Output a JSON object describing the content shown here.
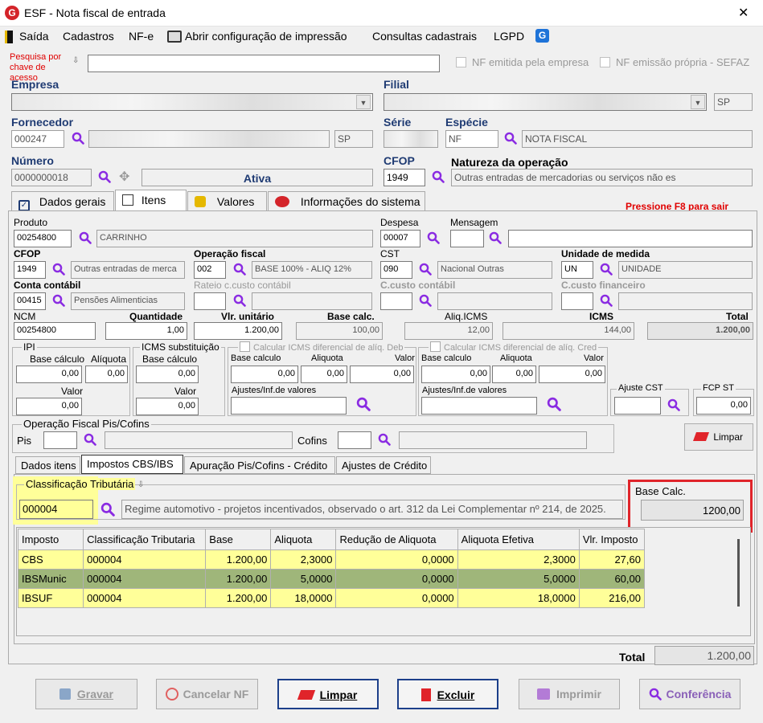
{
  "window": {
    "title": "ESF - Nota fiscal de entrada"
  },
  "menu": {
    "saida": "Saída",
    "cadastros": "Cadastros",
    "nfe": "NF-e",
    "print": "Abrir configuração de impressão",
    "consultas": "Consultas cadastrais",
    "lgpd": "LGPD"
  },
  "search": {
    "label": "Pesquisa por chave de acesso",
    "value": ""
  },
  "flags": {
    "nf_empresa": "NF emitida pela empresa",
    "nf_propria": "NF emissão própria - SEFAZ"
  },
  "empresa": {
    "label": "Empresa"
  },
  "filial": {
    "label": "Filial",
    "uf": "SP"
  },
  "fornecedor": {
    "label": "Fornecedor",
    "code": "000247",
    "uf": "SP"
  },
  "serie": {
    "label": "Série",
    "value": "NF"
  },
  "especie": {
    "label": "Espécie",
    "value": "NOTA FISCAL"
  },
  "numero": {
    "label": "Número",
    "value": "0000000018",
    "status": "Ativa"
  },
  "cfop": {
    "label": "CFOP",
    "value": "1949"
  },
  "natureza": {
    "label": "Natureza da operação",
    "value": "Outras entradas  de mercadorias ou serviços não es"
  },
  "tabs": [
    "Dados gerais",
    "Itens",
    "Valores",
    "Informações do sistema"
  ],
  "hint": "Pressione F8 para sair",
  "item": {
    "produto_label": "Produto",
    "produto_code": "00254800",
    "produto_name": "CARRINHO",
    "despesa_label": "Despesa",
    "despesa": "00007",
    "mensagem_label": "Mensagem",
    "cfop_label": "CFOP",
    "cfop": "1949",
    "cfop_desc": "Outras entradas  de merca",
    "opfiscal_label": "Operação fiscal",
    "opfiscal": "002",
    "opfiscal_desc": "BASE 100% - ALIQ 12%",
    "cst_label": "CST",
    "cst": "090",
    "cst_desc": "Nacional Outras",
    "unidade_label": "Unidade de medida",
    "unidade": "UN",
    "unidade_desc": "UNIDADE",
    "conta_label": "Conta contábil",
    "conta": "00415",
    "conta_desc": "Pensões Alimenticias",
    "rateio_label": "Rateio c.custo contábil",
    "ccusto_label": "C.custo contábil",
    "ccfin_label": "C.custo financeiro",
    "ncm_label": "NCM",
    "ncm": "00254800",
    "qtd_label": "Quantidade",
    "qtd": "1,00",
    "vunit_label": "Vlr. unitário",
    "vunit": "1.200,00",
    "base_label": "Base calc.",
    "base": "100,00",
    "aliq_label": "Aliq.ICMS",
    "aliq": "12,00",
    "icms_label": "ICMS",
    "icms": "144,00",
    "total_label": "Total",
    "total": "1.200,00"
  },
  "ipi": {
    "label": "IPI",
    "base_label": "Base cálculo",
    "base": "0,00",
    "aliq_label": "Alíquota",
    "aliq": "0,00",
    "valor_label": "Valor",
    "valor": "0,00"
  },
  "st": {
    "label": "ICMS substituição",
    "base_label": "Base cálculo",
    "base": "0,00",
    "valor_label": "Valor",
    "valor": "0,00"
  },
  "difdeb": {
    "label": "Calcular ICMS diferencial de alíq. Deb",
    "base_label": "Base calculo",
    "base": "0,00",
    "aliq_label": "Aliquota",
    "aliq": "0,00",
    "valor_label": "Valor",
    "valor": "0,00",
    "ajuste_label": "Ajustes/Inf.de valores"
  },
  "difcred": {
    "label": "Calcular ICMS diferencial de alíq. Cred",
    "base_label": "Base calculo",
    "base": "0,00",
    "aliq_label": "Aliquota",
    "aliq": "0,00",
    "valor_label": "Valor",
    "valor": "0,00",
    "ajuste_label": "Ajustes/Inf.de valores"
  },
  "ajustecst": {
    "label": "Ajuste CST"
  },
  "fcpst": {
    "label": "FCP ST",
    "value": "0,00"
  },
  "piscofins": {
    "label": "Operação Fiscal Pis/Cofins",
    "pis_label": "Pis",
    "cofins_label": "Cofins"
  },
  "limpar_small": "Limpar",
  "subtabs": [
    "Dados itens",
    "Impostos CBS/IBS",
    "Apuração Pis/Cofins - Crédito",
    "Ajustes de Crédito"
  ],
  "classif": {
    "label": "Classificação Tributária",
    "code": "000004",
    "desc": "Regime automotivo - projetos incentivados, observado o art. 312 da Lei Complementar nº 214, de 2025."
  },
  "basecalc": {
    "label": "Base Calc.",
    "value": "1200,00"
  },
  "grid": {
    "headers": [
      "Imposto",
      "Classificação Tributaria",
      "Base",
      "Aliquota",
      "Redução de Aliquota",
      "Aliquota Efetiva",
      "Vlr. Imposto"
    ],
    "rows": [
      [
        "CBS",
        "000004",
        "1.200,00",
        "2,3000",
        "0,0000",
        "2,3000",
        "27,60"
      ],
      [
        "IBSMunic",
        "000004",
        "1.200,00",
        "5,0000",
        "0,0000",
        "5,0000",
        "60,00"
      ],
      [
        "IBSUF",
        "000004",
        "1.200,00",
        "18,0000",
        "0,0000",
        "18,0000",
        "216,00"
      ]
    ]
  },
  "footer": {
    "total_label": "Total",
    "total": "1.200,00"
  },
  "buttons": {
    "gravar": "Gravar",
    "cancelar": "Cancelar NF",
    "limpar": "Limpar",
    "excluir": "Excluir",
    "imprimir": "Imprimir",
    "conferencia": "Conferência"
  },
  "colors": {
    "accent": "#1f3b73",
    "highlight": "#ffff99",
    "row_selected": "#9fb67a",
    "hint": "#e00000",
    "magnifier": "#8a2be2"
  }
}
